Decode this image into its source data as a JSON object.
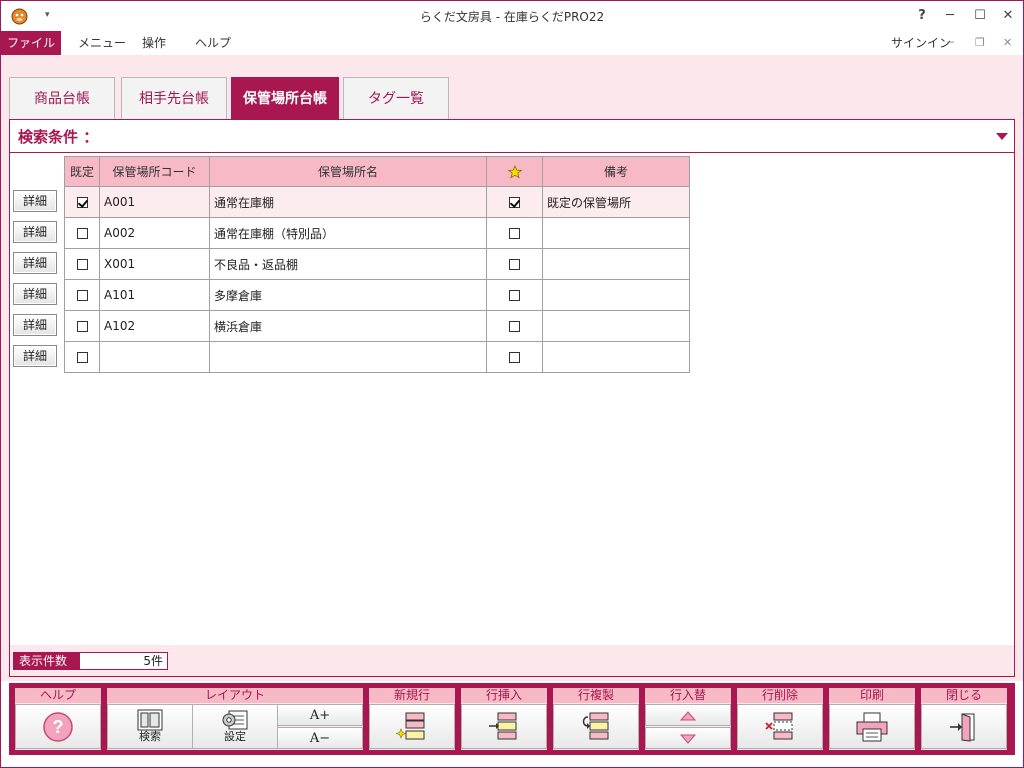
{
  "window": {
    "title": "らくだ文房具 - 在庫らくだPRO22",
    "help_glyph": "?",
    "minimize_glyph": "─",
    "maximize_glyph": "☐",
    "close_glyph": "✕"
  },
  "menu": {
    "items": [
      "ファイル",
      "メニュー",
      "操作",
      "ヘルプ"
    ],
    "signin": "サインイン"
  },
  "tabs": [
    {
      "label": "商品台帳",
      "active": false
    },
    {
      "label": "相手先台帳",
      "active": false
    },
    {
      "label": "保管場所台帳",
      "active": true
    },
    {
      "label": "タグ一覧",
      "active": false
    }
  ],
  "search": {
    "label": "検索条件 ："
  },
  "table": {
    "headers": [
      "既定",
      "保管場所コード",
      "保管場所名",
      "★",
      "備考"
    ],
    "detail_label": "詳細",
    "rows": [
      {
        "default": true,
        "code": "A001",
        "name": "通常在庫棚",
        "star": true,
        "note": "既定の保管場所"
      },
      {
        "default": false,
        "code": "A002",
        "name": "通常在庫棚（特別品）",
        "star": false,
        "note": ""
      },
      {
        "default": false,
        "code": "X001",
        "name": "不良品・返品棚",
        "star": false,
        "note": ""
      },
      {
        "default": false,
        "code": "A101",
        "name": "多摩倉庫",
        "star": false,
        "note": ""
      },
      {
        "default": false,
        "code": "A102",
        "name": "横浜倉庫",
        "star": false,
        "note": ""
      },
      {
        "default": false,
        "code": "",
        "name": "",
        "star": false,
        "note": ""
      }
    ]
  },
  "count": {
    "label": "表示件数",
    "value": "5件"
  },
  "toolbar": {
    "help": {
      "head": "ヘルプ"
    },
    "layout": {
      "head": "レイアウト",
      "search": "検索",
      "settings": "設定",
      "font_up": "A+",
      "font_down": "A−"
    },
    "new_row": {
      "head": "新規行"
    },
    "insert_row": {
      "head": "行挿入"
    },
    "copy_row": {
      "head": "行複製"
    },
    "swap_row": {
      "head": "行入替"
    },
    "delete_row": {
      "head": "行削除"
    },
    "print": {
      "head": "印刷"
    },
    "close": {
      "head": "閉じる"
    }
  },
  "colors": {
    "accent": "#a8174f",
    "header_pink": "#f6b9c5",
    "panel_pink": "#fbe7ec"
  }
}
